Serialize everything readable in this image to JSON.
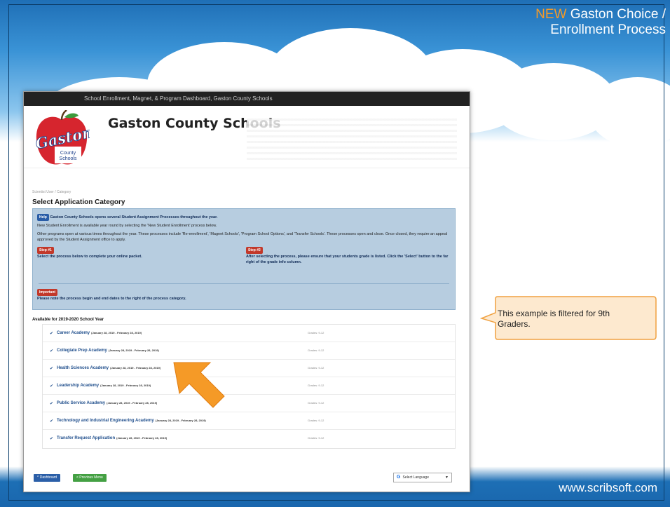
{
  "slide": {
    "title_new": "NEW",
    "title_line1": "Gaston Choice /",
    "title_line2": "Enrollment Process",
    "website": "www.scribsoft.com",
    "callout": "This example is filtered for 9th Graders.",
    "colors": {
      "accent_orange": "#f59a27",
      "brand_blue": "#1d6fb5"
    }
  },
  "app": {
    "topbar": "School Enrollment, Magnet, & Program Dashboard, Gaston County Schools",
    "logo_text_gaston": "Gaston",
    "logo_text_county": "County",
    "logo_text_schools": "Schools",
    "school_name": "Gaston County Schools",
    "breadcrumb": "Scientist User / Category",
    "heading": "Select Application Category",
    "info": {
      "help_badge": "Help",
      "help_line": "Gaston County Schools opens several Student Assignment Processes throughout the year.",
      "para1": "New Student Enrollment is available year round by selecting the 'New Student Enrollment' process below.",
      "para2": "Other programs open at various times throughout the year. These processes include 'Re-enrollment', 'Magnet Schools', 'Program School Options', and 'Transfer Schools'. These processes open and close. Once closed, they require an appeal approved by the Student Assignment office to apply.",
      "step1_badge": "Step #1",
      "step1_text": "Select the process below to complete your online packet.",
      "step2_badge": "Step #2",
      "step2_text": "After selecting the process, please ensure that your students grade is listed. Click the 'Select' button to the far right of the grade info column.",
      "important_badge": "Important",
      "important_text": "Please note the process begin and end dates to the right of the process category."
    },
    "list_title": "Available for 2019-2020 School Year",
    "academies": [
      {
        "name": "Career Academy",
        "dates": "(January 28, 2019 - February 28, 2019)",
        "grades": "Grades: 9-12"
      },
      {
        "name": "Collegiate Prep Academy",
        "dates": "(January 28, 2019 - February 28, 2019)",
        "grades": "Grades: 9-12"
      },
      {
        "name": "Health Sciences Academy",
        "dates": "(January 28, 2019 - February 28, 2019)",
        "grades": "Grades: 9-12"
      },
      {
        "name": "Leadership Academy",
        "dates": "(January 28, 2019 - February 28, 2019)",
        "grades": "Grades: 9-12"
      },
      {
        "name": "Public Service Academy",
        "dates": "(January 28, 2019 - February 28, 2019)",
        "grades": "Grades: 9-12"
      },
      {
        "name": "Technology and Industrial Engineering Academy",
        "dates": "(January 28, 2019 - February 28, 2019)",
        "grades": "Grades: 9-12"
      },
      {
        "name": "Transfer Request Application",
        "dates": "(January 28, 2019 - February 28, 2019)",
        "grades": "Grades: 9-12"
      }
    ],
    "buttons": {
      "dashboard": "^ Dashboard",
      "previous": "< Previous Menu"
    },
    "language": {
      "g": "G",
      "label": "Select Language",
      "caret": "▼"
    }
  }
}
